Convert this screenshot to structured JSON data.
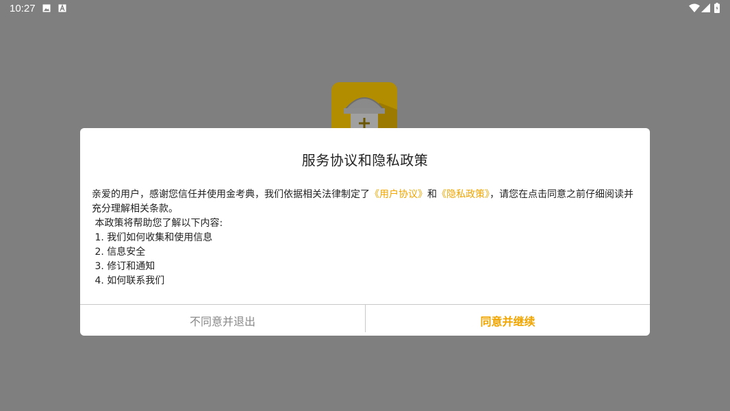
{
  "status_bar": {
    "time": "10:27",
    "icons": [
      "image-icon",
      "text-icon",
      "wifi-icon",
      "signal-icon",
      "battery-icon"
    ]
  },
  "background": {
    "color": "#7f7f7f"
  },
  "dialog": {
    "title": "服务协议和隐私政策",
    "intro_before": "亲爱的用户，感谢您信任并使用金考典，我们依据相关法律制定了",
    "link_user_agreement": "《用户协议》",
    "and_text": "和",
    "link_privacy_policy": "《隐私政策》",
    "intro_after": "，请您在点击同意之前仔细阅读并",
    "intro_line2": "充分理解相关条款。",
    "policy_heading": " 本政策将帮助您了解以下内容:",
    "items": [
      " 1. 我们如何收集和使用信息",
      " 2. 信息安全",
      " 3. 修订和通知",
      " 4. 如何联系我们"
    ],
    "decline_label": "不同意并退出",
    "agree_label": "同意并继续"
  },
  "colors": {
    "accent": "#f0a500",
    "overlay": "#7f7f7f"
  }
}
